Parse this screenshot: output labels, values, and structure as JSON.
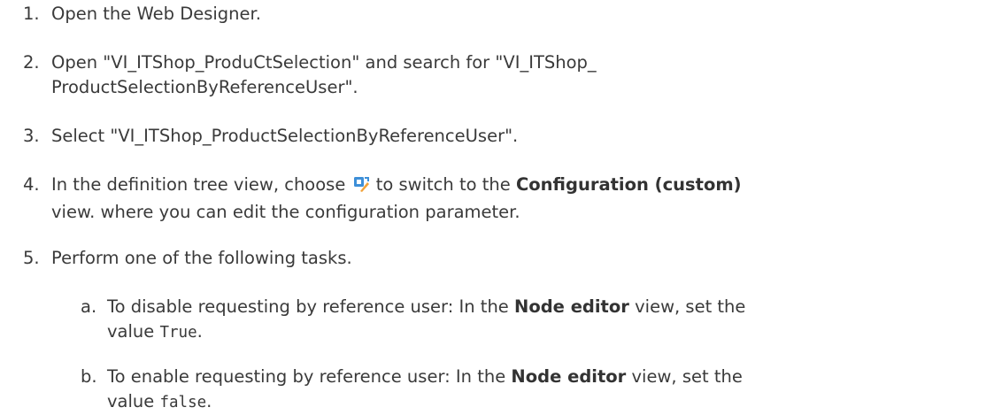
{
  "steps": [
    {
      "num": "1.",
      "text": "Open the Web Designer."
    },
    {
      "num": "2.",
      "line1": "Open \"VI_ITShop_ProduCtSelection\" and search for \"VI_ITShop_",
      "line2": "ProductSelectionByReferenceUser\"."
    },
    {
      "num": "3.",
      "text": "Select \"VI_ITShop_ProductSelectionByReferenceUser\"."
    },
    {
      "num": "4.",
      "pre": "In the definition tree view, choose",
      "post": "to switch to the",
      "bold": "Configuration (custom)",
      "line2": "view. where you can edit the configuration parameter."
    },
    {
      "num": "5.",
      "text": "Perform one of the following tasks."
    }
  ],
  "substeps": [
    {
      "num": "a.",
      "pre": "To disable requesting by reference user: In the",
      "bold": "Node editor",
      "post": "view, set the",
      "line2_pre": "value",
      "code": "True",
      "line2_post": "."
    },
    {
      "num": "b.",
      "pre": "To enable requesting by reference user: In the",
      "bold": "Node editor",
      "post": "view, set the",
      "line2_pre": "value",
      "code": "false",
      "line2_post": "."
    }
  ],
  "icon": {
    "name": "configuration-custom-icon",
    "colors": [
      "#3d8fd8",
      "#f2a33a"
    ]
  }
}
